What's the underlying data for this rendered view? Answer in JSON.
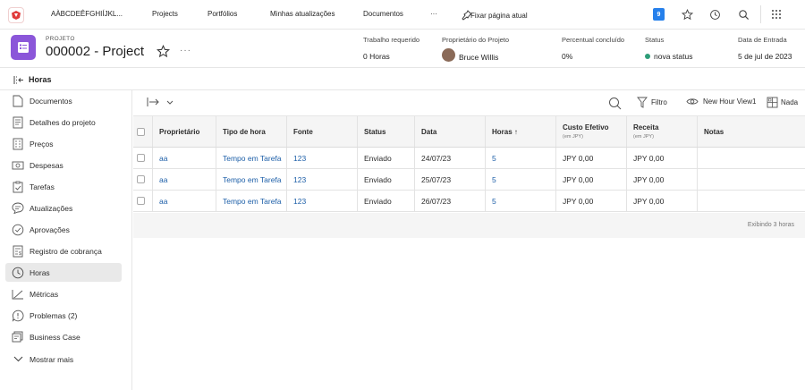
{
  "topnav": {
    "items": [
      "AÀBCDEÊFGHIÍJKL...",
      "Projects",
      "Portfólios",
      "Minhas atualizações",
      "Documentos",
      "···",
      "Fixar página atual"
    ],
    "notification_count": "9",
    "brand_color": "#e03a3a"
  },
  "project": {
    "label": "PROJETO",
    "title": "000002 - Project",
    "icon_color": "#8b56d9",
    "fields": {
      "hours_label": "Trabalho requerido",
      "hours_value": "0 Horas",
      "owner_label": "Proprietário do Projeto",
      "owner_value": "Bruce Willis",
      "percent_label": "Percentual concluído",
      "percent_value": "0%",
      "status_label": "Status",
      "status_value": "nova status",
      "status_color": "#2d9d78",
      "entry_label": "Data de Entrada",
      "entry_value": "5 de jul de 2023"
    }
  },
  "breadcrumb": {
    "title": "Horas"
  },
  "sidebar": {
    "items": [
      {
        "label": "Documentos",
        "icon": "document-icon"
      },
      {
        "label": "Detalhes do projeto",
        "icon": "details-icon"
      },
      {
        "label": "Preços",
        "icon": "pricing-icon"
      },
      {
        "label": "Despesas",
        "icon": "expenses-icon"
      },
      {
        "label": "Tarefas",
        "icon": "tasks-icon"
      },
      {
        "label": "Atualizações",
        "icon": "updates-icon"
      },
      {
        "label": "Aprovações",
        "icon": "approvals-icon"
      },
      {
        "label": "Registro de cobrança",
        "icon": "billing-icon"
      },
      {
        "label": "Horas",
        "icon": "clock-icon"
      },
      {
        "label": "Métricas",
        "icon": "metrics-icon"
      },
      {
        "label": "Problemas (2)",
        "icon": "issues-icon"
      },
      {
        "label": "Business Case",
        "icon": "business-case-icon"
      },
      {
        "label": "Mostrar mais",
        "icon": "chevron-down-icon"
      }
    ],
    "active_index": 8
  },
  "toolbar": {
    "filter_label": "Filtro",
    "view_label": "New Hour View1",
    "group_label": "Nada"
  },
  "table": {
    "columns": [
      {
        "label": "Proprietário",
        "sub": ""
      },
      {
        "label": "Tipo de hora",
        "sub": ""
      },
      {
        "label": "Fonte",
        "sub": ""
      },
      {
        "label": "Status",
        "sub": ""
      },
      {
        "label": "Data",
        "sub": ""
      },
      {
        "label": "Horas ↑",
        "sub": ""
      },
      {
        "label": "Custo Efetivo",
        "sub": "(em JPY)"
      },
      {
        "label": "Receita",
        "sub": "(em JPY)"
      },
      {
        "label": "Notas",
        "sub": ""
      }
    ],
    "rows": [
      [
        "aa",
        "Tempo em Tarefa",
        "123",
        "Enviado",
        "24/07/23",
        "5",
        "JPY 0,00",
        "JPY 0,00",
        ""
      ],
      [
        "aa",
        "Tempo em Tarefa",
        "123",
        "Enviado",
        "25/07/23",
        "5",
        "JPY 0,00",
        "JPY 0,00",
        ""
      ],
      [
        "aa",
        "Tempo em Tarefa",
        "123",
        "Enviado",
        "26/07/23",
        "5",
        "JPY 0,00",
        "JPY 0,00",
        ""
      ]
    ],
    "footer": "Exibindo 3 horas"
  }
}
